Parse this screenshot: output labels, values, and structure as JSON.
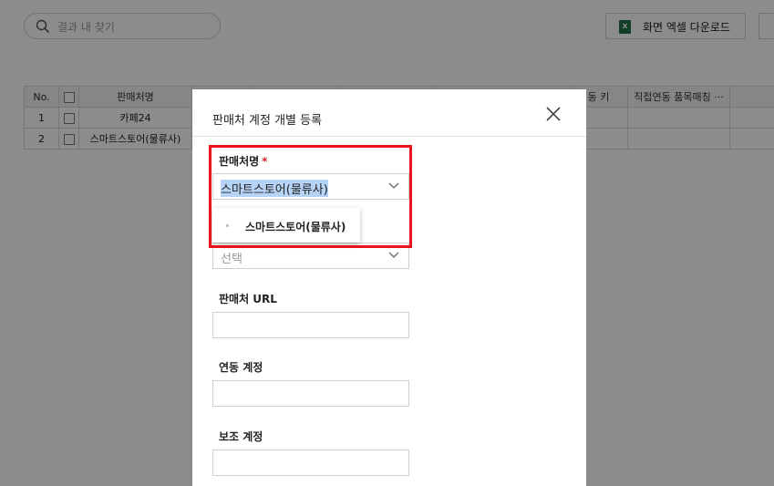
{
  "toolbar": {
    "search_placeholder": "결과 내 찾기",
    "excel_download_label": "화면 엑셀 다운로드"
  },
  "table": {
    "headers": [
      "No.",
      "",
      "판매처명",
      "",
      "",
      "",
      "",
      "동 키",
      "직접연동 품목매칭 ···"
    ],
    "rows": [
      {
        "no": "1",
        "name": "카페24"
      },
      {
        "no": "2",
        "name": "스마트스토어(물류사)"
      }
    ]
  },
  "modal": {
    "title": "판매처 계정 개별 등록",
    "fields": {
      "seller_name": {
        "label": "판매처명",
        "required_mark": "*",
        "value": "스마트스토어(물류사)"
      },
      "second_select": {
        "placeholder": "선택"
      },
      "seller_url": {
        "label": "판매처 URL",
        "value": ""
      },
      "linked_account": {
        "label": "연동 계정",
        "value": ""
      },
      "sub_account": {
        "label": "보조 계정",
        "value": ""
      }
    },
    "dropdown_options": [
      "스마트스토어(물류사)"
    ]
  },
  "colors": {
    "highlight": "#e8141c",
    "required": "#d9262b",
    "selection": "#b6d3f5",
    "excel": "#1e7145"
  },
  "icons": [
    "search-icon",
    "excel-icon",
    "close-icon",
    "chevron-down-icon"
  ]
}
